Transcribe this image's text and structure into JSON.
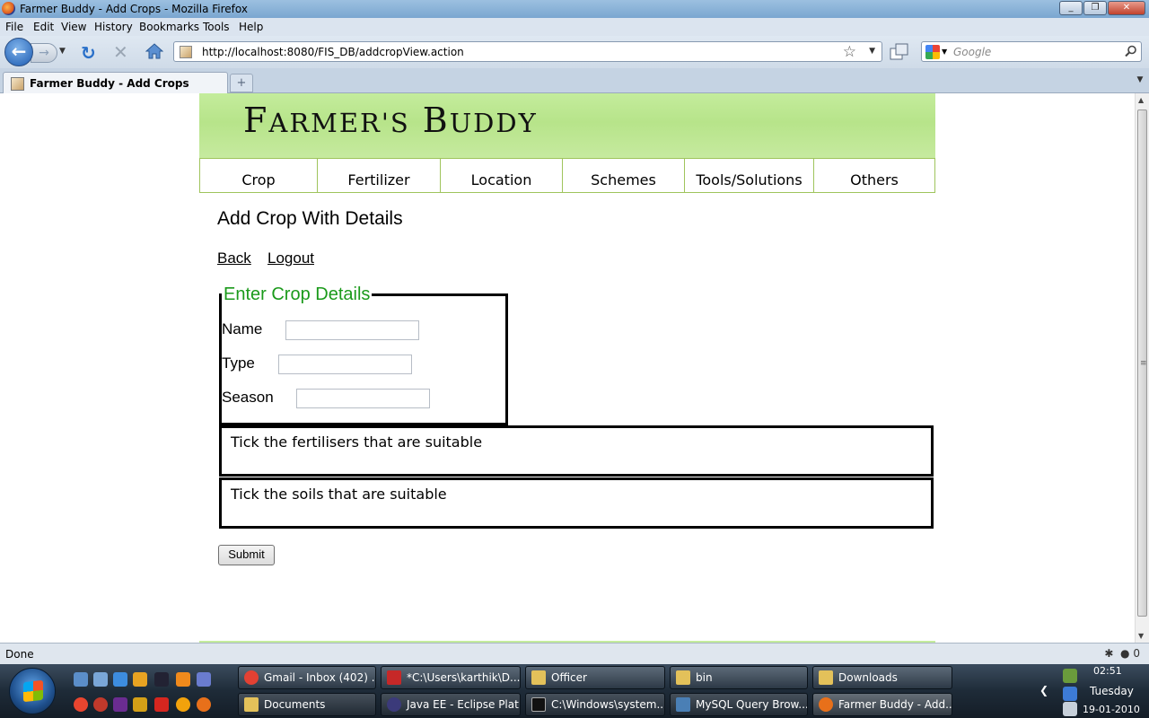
{
  "window": {
    "title": "Farmer Buddy - Add Crops - Mozilla Firefox"
  },
  "menu": [
    "File",
    "Edit",
    "View",
    "History",
    "Bookmarks",
    "Tools",
    "Help"
  ],
  "url": "http://localhost:8080/FIS_DB/addcropView.action",
  "search_placeholder": "Google",
  "tab": {
    "label": "Farmer Buddy - Add Crops",
    "new_tab": "+"
  },
  "site": {
    "logo_big_1": "F",
    "logo_small_1": "ARMER'S",
    "logo_big_2": "B",
    "logo_small_2": "UDDY",
    "nav": [
      "Crop",
      "Fertilizer",
      "Location",
      "Schemes",
      "Tools/Solutions",
      "Others"
    ]
  },
  "page": {
    "heading": "Add Crop With Details",
    "links": {
      "back": "Back",
      "logout": "Logout"
    },
    "legend": "Enter Crop Details",
    "fields": {
      "name": "Name",
      "type": "Type",
      "season": "Season"
    },
    "fertilisers_label": "Tick the fertilisers that are suitable",
    "soils_label": "Tick the soils that are suitable",
    "submit": "Submit"
  },
  "status": {
    "text": "Done",
    "count": "0"
  },
  "taskbar": {
    "row1": [
      "Gmail - Inbox (402) ...",
      "*C:\\Users\\karthik\\D...",
      "Officer",
      "bin",
      "Downloads"
    ],
    "row2": [
      "Documents",
      "Java EE - Eclipse Plat...",
      "C:\\Windows\\system...",
      "MySQL Query Brow...",
      "Farmer Buddy - Add..."
    ],
    "clock": {
      "time": "02:51",
      "day": "Tuesday",
      "date": "19-01-2010"
    }
  },
  "colors": {
    "banner_green": "#c4ec9c",
    "legend_green": "#1b9a1b",
    "nav_border": "#9fc45c"
  }
}
